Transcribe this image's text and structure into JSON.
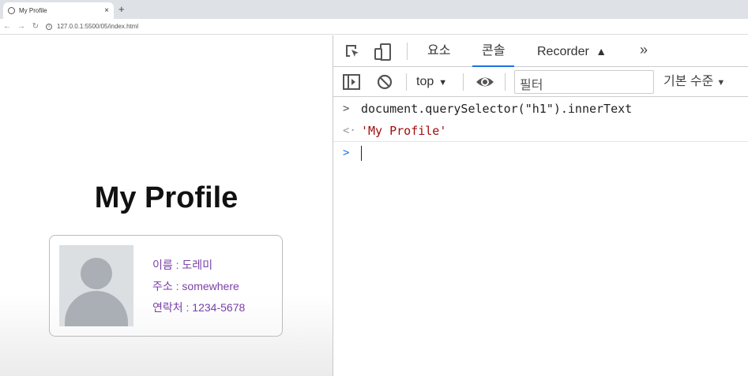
{
  "browser": {
    "tab_title": "My Profile",
    "new_tab": "+",
    "tab_close": "×",
    "url": "127.0.0.1:5500/05/index.html"
  },
  "page": {
    "title": "My Profile",
    "name": "이름 : 도레미",
    "address": "주소 : somewhere",
    "contact": "연락처 : 1234-5678"
  },
  "devtools": {
    "tabs": [
      {
        "label": "요소",
        "active": false
      },
      {
        "label": "콘솔",
        "active": true
      },
      {
        "label": "Recorder",
        "active": false
      }
    ],
    "more": "»",
    "context": "top",
    "filter_placeholder": "필터",
    "levels": "기본 수준",
    "console_lines": {
      "input": "document.querySelector(\"h1\").innerText",
      "output": "'My Profile'"
    },
    "prompt_arrow": ">",
    "input_arrow": ">",
    "output_arrow": "<·"
  },
  "colors": {
    "info_text": "#7a3fa8",
    "accent": "#1a73e8",
    "string_output": "#a10d0d"
  }
}
